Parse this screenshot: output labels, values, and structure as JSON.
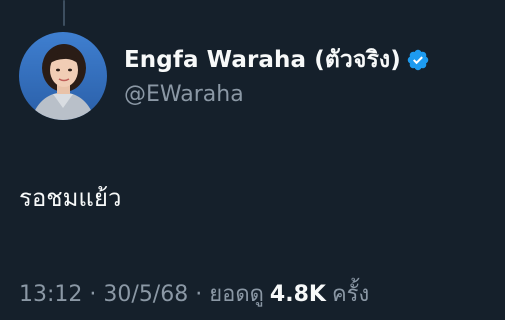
{
  "author": {
    "display_name": "Engfa Waraha (ตัวจริง)",
    "handle": "@EWaraha",
    "verified": true
  },
  "tweet": {
    "text": "รอชมแย้ว"
  },
  "meta": {
    "time": "13:12",
    "separator": "·",
    "date": "30/5/68",
    "views_prefix": "ยอดดู",
    "views_count": "4.8K",
    "views_suffix": "ครั้ง"
  },
  "colors": {
    "background": "#15202b",
    "verified_badge": "#1d9bf0",
    "primary_text": "#f7f9f9",
    "secondary_text": "#8b98a5"
  },
  "icons": {
    "verified": "verified-badge-icon"
  }
}
